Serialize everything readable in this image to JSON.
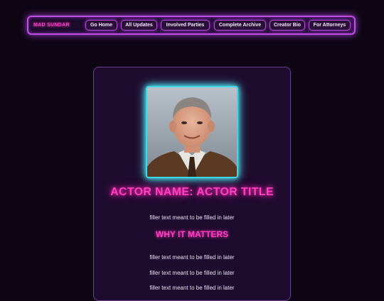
{
  "nav": {
    "brand": "MAD SUNDAR",
    "items": [
      {
        "label": "Go Home"
      },
      {
        "label": "All Updates"
      },
      {
        "label": "Involved Parties"
      },
      {
        "label": "Complete Archive"
      },
      {
        "label": "Creator Bio"
      },
      {
        "label": "For Attorneys"
      }
    ]
  },
  "profile": {
    "title": "ACTOR NAME: ACTOR TITLE",
    "intro": "filler text meant to be filled in later",
    "section_heading": "WHY IT MATTERS",
    "paragraphs": [
      "filler text meant to be filled in later",
      "filler text meant to be filled in later",
      "filler text meant to be filled in later"
    ]
  },
  "colors": {
    "background": "#0e0614",
    "neon_pink": "#ff3fbf",
    "neon_purple": "#c04fe0",
    "neon_cyan": "#3fd7e6"
  }
}
